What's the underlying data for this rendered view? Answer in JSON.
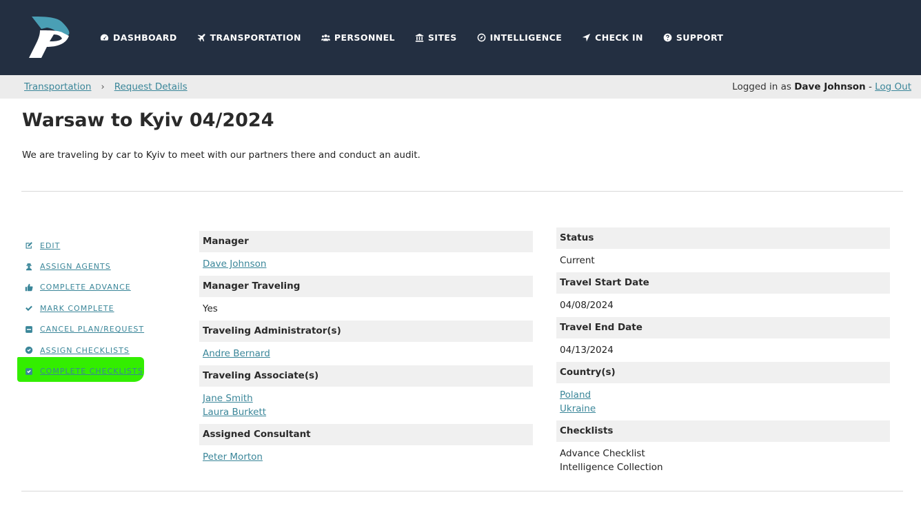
{
  "nav": {
    "items": [
      {
        "label": "DASHBOARD",
        "icon": "dashboard-icon"
      },
      {
        "label": "TRANSPORTATION",
        "icon": "plane-icon"
      },
      {
        "label": "PERSONNEL",
        "icon": "users-icon"
      },
      {
        "label": "SITES",
        "icon": "bank-icon"
      },
      {
        "label": "INTELLIGENCE",
        "icon": "compass-icon"
      },
      {
        "label": "CHECK IN",
        "icon": "location-arrow-icon"
      },
      {
        "label": "SUPPORT",
        "icon": "question-circle-icon"
      }
    ]
  },
  "breadcrumb": {
    "items": [
      "Transportation",
      "Request Details"
    ],
    "separator": "›"
  },
  "session": {
    "prefix": "Logged in as",
    "user": "Dave Johnson",
    "dash": "-",
    "logout": "Log Out"
  },
  "page": {
    "title": "Warsaw to Kyiv 04/2024",
    "description": "We are traveling by car to Kyiv to meet with our partners there and conduct an audit."
  },
  "actions": [
    {
      "label": "EDIT",
      "icon": "edit-icon"
    },
    {
      "label": "ASSIGN AGENTS",
      "icon": "user-secret-icon"
    },
    {
      "label": "COMPLETE ADVANCE",
      "icon": "thumbs-up-icon"
    },
    {
      "label": "MARK COMPLETE",
      "icon": "check-icon"
    },
    {
      "label": "CANCEL PLAN/REQUEST",
      "icon": "minus-square-icon"
    },
    {
      "label": "ASSIGN CHECKLISTS",
      "icon": "check-circle-icon"
    },
    {
      "label": "COMPLETE CHECKLISTS",
      "icon": "check-square-icon",
      "highlighted": true
    }
  ],
  "highlight_color": "#33ee00",
  "details_left": {
    "manager_label": "Manager",
    "manager": "Dave Johnson",
    "manager_traveling_label": "Manager Traveling",
    "manager_traveling": "Yes",
    "admins_label": "Traveling Administrator(s)",
    "admins": [
      "Andre Bernard"
    ],
    "associates_label": "Traveling Associate(s)",
    "associates": [
      "Jane Smith",
      "Laura Burkett"
    ],
    "consultant_label": "Assigned Consultant",
    "consultant": "Peter Morton"
  },
  "details_right": {
    "status_label": "Status",
    "status": "Current",
    "start_label": "Travel Start Date",
    "start": "04/08/2024",
    "end_label": "Travel End Date",
    "end": "04/13/2024",
    "countries_label": "Country(s)",
    "countries": [
      "Poland",
      "Ukraine"
    ],
    "checklists_label": "Checklists",
    "checklists": [
      "Advance Checklist",
      "Intelligence Collection"
    ]
  },
  "colors": {
    "nav_bg": "#232f41",
    "logo_teal": "#4a9fb5",
    "link": "#3a8699",
    "crumb_bg": "#ececec",
    "row_head_bg": "#f0f0f0"
  }
}
